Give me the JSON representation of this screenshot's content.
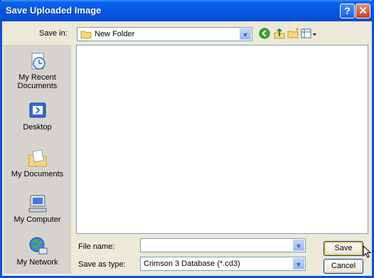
{
  "window": {
    "title": "Save Uploaded Image",
    "help_glyph": "?",
    "close_glyph": "✕"
  },
  "toolbar": {
    "save_in_label": "Save in:",
    "save_in_value": "New Folder",
    "icons": [
      "back-icon",
      "up-folder-icon",
      "new-folder-icon",
      "views-menu-icon"
    ]
  },
  "places": [
    {
      "label": "My Recent Documents",
      "icon": "recent-documents-icon"
    },
    {
      "label": "Desktop",
      "icon": "desktop-icon"
    },
    {
      "label": "My Documents",
      "icon": "my-documents-icon"
    },
    {
      "label": "My Computer",
      "icon": "my-computer-icon"
    },
    {
      "label": "My Network",
      "icon": "my-network-icon"
    }
  ],
  "form": {
    "file_name_label": "File name:",
    "file_name_value": "",
    "save_as_type_label": "Save as type:",
    "save_as_type_value": "Crimson 3 Database (*.cd3)"
  },
  "buttons": {
    "save_label": "Save",
    "cancel_label": "Cancel"
  },
  "colors": {
    "titlebar": "#0453dc",
    "dialog_bg": "#ece9d8",
    "places_bg": "#d6d3ce"
  }
}
